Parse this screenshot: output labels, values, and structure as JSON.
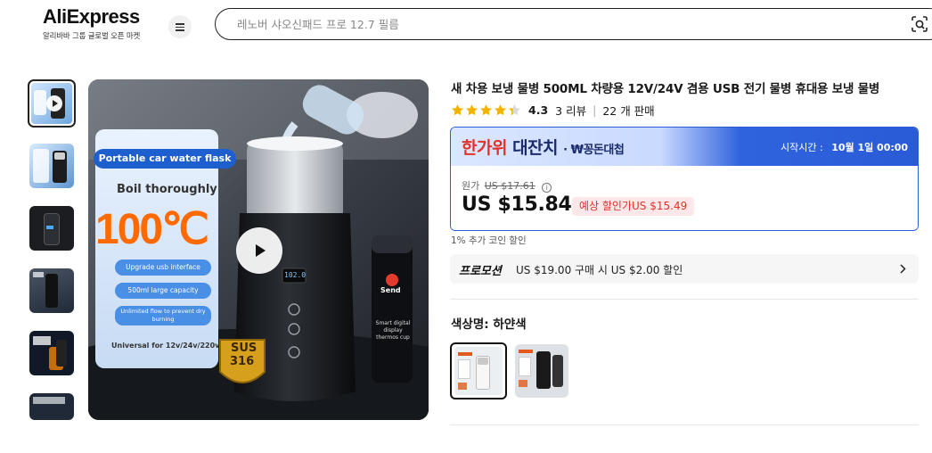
{
  "header": {
    "logo_text": "AliExpress",
    "logo_subtitle": "알리바바 그룹 글로벌 오픈 마켓",
    "search_placeholder": "레노버 샤오신패드 프로 12.7 필름"
  },
  "gallery": {
    "thumbnails": [
      {
        "name": "thumb-1",
        "active": true,
        "has_play": true
      },
      {
        "name": "thumb-2",
        "active": false
      },
      {
        "name": "thumb-3",
        "active": false
      },
      {
        "name": "thumb-4",
        "active": false
      },
      {
        "name": "thumb-5",
        "active": false
      },
      {
        "name": "thumb-6",
        "active": false
      }
    ],
    "main_image": {
      "banner": "Portable car water flask",
      "boil": "Boil thoroughly",
      "temp": "100℃",
      "features": [
        "Upgrade usb interface",
        "500ml large capacity",
        "Unlimited flow to prevent dry burning"
      ],
      "universal": "Universal for 12v/24v/220v",
      "badge_main": "SUS",
      "badge_num": "316",
      "display": "102.0",
      "send": "Send",
      "cup_caption": "Smart digital display thermos cup"
    }
  },
  "product": {
    "title": "새 차용 보냉 물병 500ML 차량용 12V/24V 겸용 USB 전기 물병 휴대용 보냉 물병",
    "rating": "4.3",
    "rating_stars": 4.3,
    "reviews": "3 리뷰",
    "sold": "22 개 판매"
  },
  "promo": {
    "title_part1": "한가위",
    "title_part2": "대잔치",
    "title_part3": "· ₩꽁돈대첩",
    "start_label": "시작시간 :",
    "start_time": "10월 1일 00:00",
    "orig_label": "원가",
    "orig_price": "US $17.61",
    "price": "US $15.84",
    "est_price": "예상 할인가US $15.49"
  },
  "coin_note": "1% 추가 코인 할인",
  "promotion": {
    "label": "프로모션",
    "text": "US $19.00 구매 시 US $2.00 할인"
  },
  "color": {
    "label": "색상명: 하얀색",
    "options": [
      {
        "name": "하얀색",
        "selected": true
      },
      {
        "name": "블랙",
        "selected": false
      }
    ]
  },
  "colors": {
    "accent_blue": "#2a5bd7",
    "price_red": "#e0322b",
    "star": "#f5b301"
  }
}
